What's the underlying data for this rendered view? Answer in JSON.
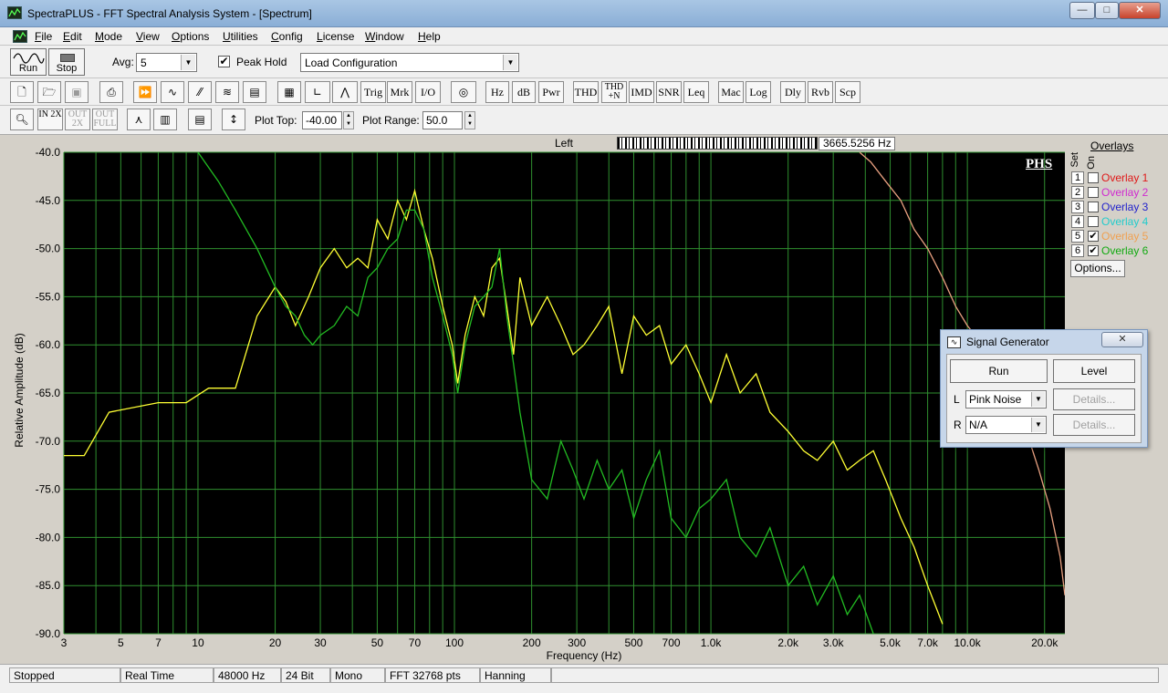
{
  "window": {
    "title": "SpectraPLUS - FFT Spectral Analysis System - [Spectrum]",
    "min_glyph": "—",
    "max_glyph": "□",
    "close_glyph": "✕"
  },
  "menu": [
    {
      "first": "F",
      "rest": "ile"
    },
    {
      "first": "E",
      "rest": "dit"
    },
    {
      "first": "M",
      "rest": "ode"
    },
    {
      "first": "V",
      "rest": "iew"
    },
    {
      "first": "O",
      "rest": "ptions"
    },
    {
      "first": "U",
      "rest": "tilities"
    },
    {
      "first": "C",
      "rest": "onfig"
    },
    {
      "first": "L",
      "rest": "icense"
    },
    {
      "first": "W",
      "rest": "indow"
    },
    {
      "first": "H",
      "rest": "elp"
    }
  ],
  "toolbar": {
    "run_label": "Run",
    "stop_label": "Stop",
    "avg_label": "Avg:",
    "avg_value": "5",
    "peak_hold_label": "Peak Hold",
    "peak_hold_check": "✔",
    "config_value": "Load Configuration",
    "buttons2": [
      "Trig",
      "Mrk",
      "I/O",
      "Hz",
      "dB",
      "Pwr",
      "THD",
      "THD +N",
      "IMD",
      "SNR",
      "Leq",
      "Mac",
      "Log",
      "Dly",
      "Rvb",
      "Scp"
    ],
    "zoom_in": "IN 2X",
    "zoom_out": "OUT 2X",
    "zoom_full": "OUT FULL",
    "plot_top_label": "Plot Top:",
    "plot_top_value": "-40.00",
    "plot_range_label": "Plot Range:",
    "plot_range_value": "50.0"
  },
  "cursor": {
    "channel": "Left",
    "readout": "3665.5256 Hz"
  },
  "chart_data": {
    "type": "line",
    "xlabel": "Frequency (Hz)",
    "ylabel": "Relative Amplitude (dB)",
    "x_scale": "log",
    "xlim": [
      3,
      24000
    ],
    "ylim": [
      -90,
      -40
    ],
    "yticks": [
      -40,
      -45,
      -50,
      -55,
      -60,
      -65,
      -70,
      -75,
      -80,
      -85,
      -90
    ],
    "ytick_labels": [
      "-40.0",
      "-45.0",
      "-50.0",
      "-55.0",
      "-60.0",
      "-65.0",
      "-70.0",
      "-75.0",
      "-80.0",
      "-85.0",
      "-90.0"
    ],
    "xticks": [
      3,
      5,
      7,
      10,
      20,
      30,
      50,
      70,
      100,
      200,
      300,
      500,
      700,
      1000,
      2000,
      3000,
      5000,
      7000,
      10000,
      20000
    ],
    "xtick_labels": [
      "3",
      "5",
      "7",
      "10",
      "20",
      "30",
      "50",
      "70",
      "100",
      "200",
      "300",
      "500",
      "700",
      "1.0k",
      "2.0k",
      "3.0k",
      "5.0k",
      "7.0k",
      "10.0k",
      "20.0k"
    ],
    "grid": true,
    "background": "#000000",
    "grid_color": "#2f8f2f",
    "annotation": "PHS",
    "series": [
      {
        "color": "#ffff33",
        "x": [
          3,
          3.6,
          4.5,
          7,
          9,
          11,
          14,
          17,
          20,
          22,
          24,
          27,
          30,
          34,
          38,
          42,
          46,
          50,
          55,
          60,
          65,
          70,
          76,
          82,
          90,
          98,
          103,
          110,
          120,
          130,
          140,
          150,
          160,
          170,
          180,
          200,
          230,
          260,
          290,
          320,
          360,
          400,
          450,
          500,
          560,
          630,
          700,
          800,
          900,
          1000,
          1150,
          1300,
          1500,
          1700,
          2000,
          2300,
          2600,
          3000,
          3400,
          3800,
          4300,
          4800,
          5500,
          6200,
          7000,
          8000
        ],
        "y": [
          -71.5,
          -71.5,
          -67,
          -66,
          -66,
          -64.5,
          -64.5,
          -57,
          -54,
          -55.5,
          -58,
          -55,
          -52,
          -50,
          -52,
          -51,
          -52,
          -47,
          -49,
          -45,
          -47,
          -44,
          -48,
          -51,
          -56,
          -60,
          -64,
          -59,
          -55,
          -57,
          -52,
          -51,
          -56,
          -61,
          -53,
          -58,
          -55,
          -58,
          -61,
          -60,
          -58,
          -56,
          -63,
          -57,
          -59,
          -58,
          -62,
          -60,
          -63,
          -66,
          -61,
          -65,
          -63,
          -67,
          -69,
          -71,
          -72,
          -70,
          -73,
          -72,
          -71,
          -74,
          -78,
          -81,
          -85,
          -89
        ]
      },
      {
        "color": "#22bb22",
        "x": [
          10,
          12,
          14,
          17,
          20,
          22,
          24,
          26,
          28,
          30,
          34,
          38,
          42,
          46,
          50,
          55,
          60,
          65,
          70,
          76,
          82,
          90,
          98,
          103,
          110,
          120,
          130,
          140,
          150,
          160,
          170,
          180,
          200,
          230,
          260,
          290,
          320,
          360,
          400,
          450,
          500,
          560,
          630,
          700,
          800,
          900,
          1000,
          1150,
          1300,
          1500,
          1700,
          2000,
          2300,
          2600,
          3000,
          3400,
          3800,
          4300
        ],
        "y": [
          -40,
          -43,
          -46,
          -50,
          -54,
          -56,
          -57,
          -59,
          -60,
          -59,
          -58,
          -56,
          -57,
          -53,
          -52,
          -50,
          -49,
          -46,
          -46,
          -48,
          -53,
          -57,
          -61,
          -65,
          -60,
          -56,
          -55,
          -54,
          -50,
          -57,
          -62,
          -67,
          -74,
          -76,
          -70,
          -73,
          -76,
          -72,
          -75,
          -73,
          -78,
          -74,
          -71,
          -78,
          -80,
          -77,
          -76,
          -74,
          -80,
          -82,
          -79,
          -85,
          -83,
          -87,
          -84,
          -88,
          -86,
          -90
        ]
      },
      {
        "color": "#e8a080",
        "x": [
          3800,
          4200,
          4800,
          5500,
          6200,
          7000,
          8000,
          9000,
          10000,
          11500,
          13000,
          15000,
          17000,
          19000,
          21000,
          23000,
          24000
        ],
        "y": [
          -40,
          -41,
          -43,
          -45,
          -48,
          -50,
          -53,
          -56,
          -58,
          -60,
          -63,
          -66,
          -69,
          -73,
          -77,
          -82,
          -86
        ]
      }
    ]
  },
  "overlays": {
    "title": "Overlays",
    "set_label": "Set",
    "on_label": "On",
    "items": [
      {
        "num": "1",
        "name": "Overlay 1",
        "color": "#e01818",
        "on": ""
      },
      {
        "num": "2",
        "name": "Overlay 2",
        "color": "#d02ad0",
        "on": ""
      },
      {
        "num": "3",
        "name": "Overlay 3",
        "color": "#2222cc",
        "on": ""
      },
      {
        "num": "4",
        "name": "Overlay 4",
        "color": "#22cccc",
        "on": ""
      },
      {
        "num": "5",
        "name": "Overlay 5",
        "color": "#f0a050",
        "on": "✔"
      },
      {
        "num": "6",
        "name": "Overlay 6",
        "color": "#11aa11",
        "on": "✔"
      }
    ],
    "options_label": "Options..."
  },
  "signal_generator": {
    "title": "Signal Generator",
    "close_glyph": "✕",
    "run_label": "Run",
    "level_label": "Level",
    "left_label": "L",
    "left_value": "Pink Noise",
    "right_label": "R",
    "right_value": "N/A",
    "details_label": "Details..."
  },
  "status": {
    "state": "Stopped",
    "mode": "Real Time",
    "rate": "48000 Hz",
    "bits": "24 Bit",
    "channels": "Mono",
    "fft": "FFT 32768 pts",
    "window": "Hanning"
  }
}
